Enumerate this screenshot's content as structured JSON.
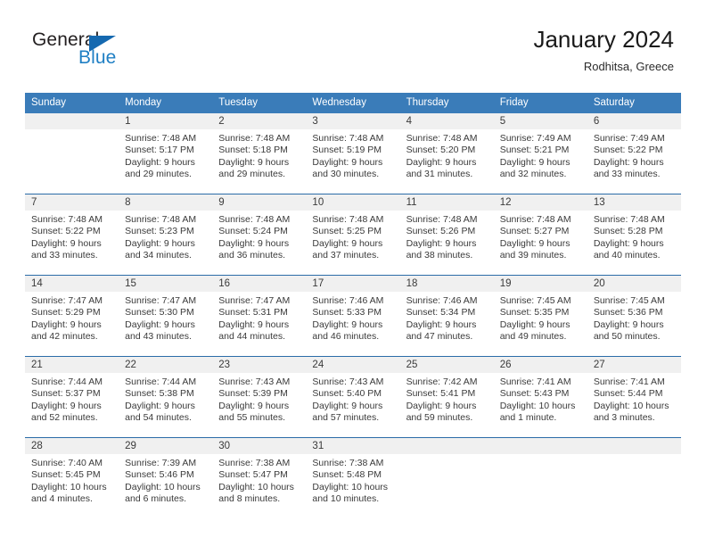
{
  "brand": {
    "name_part1": "General",
    "name_part2": "Blue",
    "logo_icon": "triangle-icon"
  },
  "header": {
    "month_title": "January 2024",
    "location": "Rodhitsa, Greece"
  },
  "colors": {
    "header_blue": "#3a7cb9",
    "separator_blue": "#2b6ca8",
    "daynum_band": "#f0f0f0",
    "brand_blue": "#1f7fc4",
    "text": "#3a3a3a"
  },
  "calendar": {
    "weekday_headers": [
      "Sunday",
      "Monday",
      "Tuesday",
      "Wednesday",
      "Thursday",
      "Friday",
      "Saturday"
    ],
    "weeks": [
      [
        {
          "day": "",
          "empty": true,
          "sunrise": "",
          "sunset": "",
          "daylight1": "",
          "daylight2": ""
        },
        {
          "day": "1",
          "empty": false,
          "sunrise": "Sunrise: 7:48 AM",
          "sunset": "Sunset: 5:17 PM",
          "daylight1": "Daylight: 9 hours",
          "daylight2": "and 29 minutes."
        },
        {
          "day": "2",
          "empty": false,
          "sunrise": "Sunrise: 7:48 AM",
          "sunset": "Sunset: 5:18 PM",
          "daylight1": "Daylight: 9 hours",
          "daylight2": "and 29 minutes."
        },
        {
          "day": "3",
          "empty": false,
          "sunrise": "Sunrise: 7:48 AM",
          "sunset": "Sunset: 5:19 PM",
          "daylight1": "Daylight: 9 hours",
          "daylight2": "and 30 minutes."
        },
        {
          "day": "4",
          "empty": false,
          "sunrise": "Sunrise: 7:48 AM",
          "sunset": "Sunset: 5:20 PM",
          "daylight1": "Daylight: 9 hours",
          "daylight2": "and 31 minutes."
        },
        {
          "day": "5",
          "empty": false,
          "sunrise": "Sunrise: 7:49 AM",
          "sunset": "Sunset: 5:21 PM",
          "daylight1": "Daylight: 9 hours",
          "daylight2": "and 32 minutes."
        },
        {
          "day": "6",
          "empty": false,
          "sunrise": "Sunrise: 7:49 AM",
          "sunset": "Sunset: 5:22 PM",
          "daylight1": "Daylight: 9 hours",
          "daylight2": "and 33 minutes."
        }
      ],
      [
        {
          "day": "7",
          "empty": false,
          "sunrise": "Sunrise: 7:48 AM",
          "sunset": "Sunset: 5:22 PM",
          "daylight1": "Daylight: 9 hours",
          "daylight2": "and 33 minutes."
        },
        {
          "day": "8",
          "empty": false,
          "sunrise": "Sunrise: 7:48 AM",
          "sunset": "Sunset: 5:23 PM",
          "daylight1": "Daylight: 9 hours",
          "daylight2": "and 34 minutes."
        },
        {
          "day": "9",
          "empty": false,
          "sunrise": "Sunrise: 7:48 AM",
          "sunset": "Sunset: 5:24 PM",
          "daylight1": "Daylight: 9 hours",
          "daylight2": "and 36 minutes."
        },
        {
          "day": "10",
          "empty": false,
          "sunrise": "Sunrise: 7:48 AM",
          "sunset": "Sunset: 5:25 PM",
          "daylight1": "Daylight: 9 hours",
          "daylight2": "and 37 minutes."
        },
        {
          "day": "11",
          "empty": false,
          "sunrise": "Sunrise: 7:48 AM",
          "sunset": "Sunset: 5:26 PM",
          "daylight1": "Daylight: 9 hours",
          "daylight2": "and 38 minutes."
        },
        {
          "day": "12",
          "empty": false,
          "sunrise": "Sunrise: 7:48 AM",
          "sunset": "Sunset: 5:27 PM",
          "daylight1": "Daylight: 9 hours",
          "daylight2": "and 39 minutes."
        },
        {
          "day": "13",
          "empty": false,
          "sunrise": "Sunrise: 7:48 AM",
          "sunset": "Sunset: 5:28 PM",
          "daylight1": "Daylight: 9 hours",
          "daylight2": "and 40 minutes."
        }
      ],
      [
        {
          "day": "14",
          "empty": false,
          "sunrise": "Sunrise: 7:47 AM",
          "sunset": "Sunset: 5:29 PM",
          "daylight1": "Daylight: 9 hours",
          "daylight2": "and 42 minutes."
        },
        {
          "day": "15",
          "empty": false,
          "sunrise": "Sunrise: 7:47 AM",
          "sunset": "Sunset: 5:30 PM",
          "daylight1": "Daylight: 9 hours",
          "daylight2": "and 43 minutes."
        },
        {
          "day": "16",
          "empty": false,
          "sunrise": "Sunrise: 7:47 AM",
          "sunset": "Sunset: 5:31 PM",
          "daylight1": "Daylight: 9 hours",
          "daylight2": "and 44 minutes."
        },
        {
          "day": "17",
          "empty": false,
          "sunrise": "Sunrise: 7:46 AM",
          "sunset": "Sunset: 5:33 PM",
          "daylight1": "Daylight: 9 hours",
          "daylight2": "and 46 minutes."
        },
        {
          "day": "18",
          "empty": false,
          "sunrise": "Sunrise: 7:46 AM",
          "sunset": "Sunset: 5:34 PM",
          "daylight1": "Daylight: 9 hours",
          "daylight2": "and 47 minutes."
        },
        {
          "day": "19",
          "empty": false,
          "sunrise": "Sunrise: 7:45 AM",
          "sunset": "Sunset: 5:35 PM",
          "daylight1": "Daylight: 9 hours",
          "daylight2": "and 49 minutes."
        },
        {
          "day": "20",
          "empty": false,
          "sunrise": "Sunrise: 7:45 AM",
          "sunset": "Sunset: 5:36 PM",
          "daylight1": "Daylight: 9 hours",
          "daylight2": "and 50 minutes."
        }
      ],
      [
        {
          "day": "21",
          "empty": false,
          "sunrise": "Sunrise: 7:44 AM",
          "sunset": "Sunset: 5:37 PM",
          "daylight1": "Daylight: 9 hours",
          "daylight2": "and 52 minutes."
        },
        {
          "day": "22",
          "empty": false,
          "sunrise": "Sunrise: 7:44 AM",
          "sunset": "Sunset: 5:38 PM",
          "daylight1": "Daylight: 9 hours",
          "daylight2": "and 54 minutes."
        },
        {
          "day": "23",
          "empty": false,
          "sunrise": "Sunrise: 7:43 AM",
          "sunset": "Sunset: 5:39 PM",
          "daylight1": "Daylight: 9 hours",
          "daylight2": "and 55 minutes."
        },
        {
          "day": "24",
          "empty": false,
          "sunrise": "Sunrise: 7:43 AM",
          "sunset": "Sunset: 5:40 PM",
          "daylight1": "Daylight: 9 hours",
          "daylight2": "and 57 minutes."
        },
        {
          "day": "25",
          "empty": false,
          "sunrise": "Sunrise: 7:42 AM",
          "sunset": "Sunset: 5:41 PM",
          "daylight1": "Daylight: 9 hours",
          "daylight2": "and 59 minutes."
        },
        {
          "day": "26",
          "empty": false,
          "sunrise": "Sunrise: 7:41 AM",
          "sunset": "Sunset: 5:43 PM",
          "daylight1": "Daylight: 10 hours",
          "daylight2": "and 1 minute."
        },
        {
          "day": "27",
          "empty": false,
          "sunrise": "Sunrise: 7:41 AM",
          "sunset": "Sunset: 5:44 PM",
          "daylight1": "Daylight: 10 hours",
          "daylight2": "and 3 minutes."
        }
      ],
      [
        {
          "day": "28",
          "empty": false,
          "sunrise": "Sunrise: 7:40 AM",
          "sunset": "Sunset: 5:45 PM",
          "daylight1": "Daylight: 10 hours",
          "daylight2": "and 4 minutes."
        },
        {
          "day": "29",
          "empty": false,
          "sunrise": "Sunrise: 7:39 AM",
          "sunset": "Sunset: 5:46 PM",
          "daylight1": "Daylight: 10 hours",
          "daylight2": "and 6 minutes."
        },
        {
          "day": "30",
          "empty": false,
          "sunrise": "Sunrise: 7:38 AM",
          "sunset": "Sunset: 5:47 PM",
          "daylight1": "Daylight: 10 hours",
          "daylight2": "and 8 minutes."
        },
        {
          "day": "31",
          "empty": false,
          "sunrise": "Sunrise: 7:38 AM",
          "sunset": "Sunset: 5:48 PM",
          "daylight1": "Daylight: 10 hours",
          "daylight2": "and 10 minutes."
        },
        {
          "day": "",
          "empty": true,
          "sunrise": "",
          "sunset": "",
          "daylight1": "",
          "daylight2": ""
        },
        {
          "day": "",
          "empty": true,
          "sunrise": "",
          "sunset": "",
          "daylight1": "",
          "daylight2": ""
        },
        {
          "day": "",
          "empty": true,
          "sunrise": "",
          "sunset": "",
          "daylight1": "",
          "daylight2": ""
        }
      ]
    ]
  }
}
